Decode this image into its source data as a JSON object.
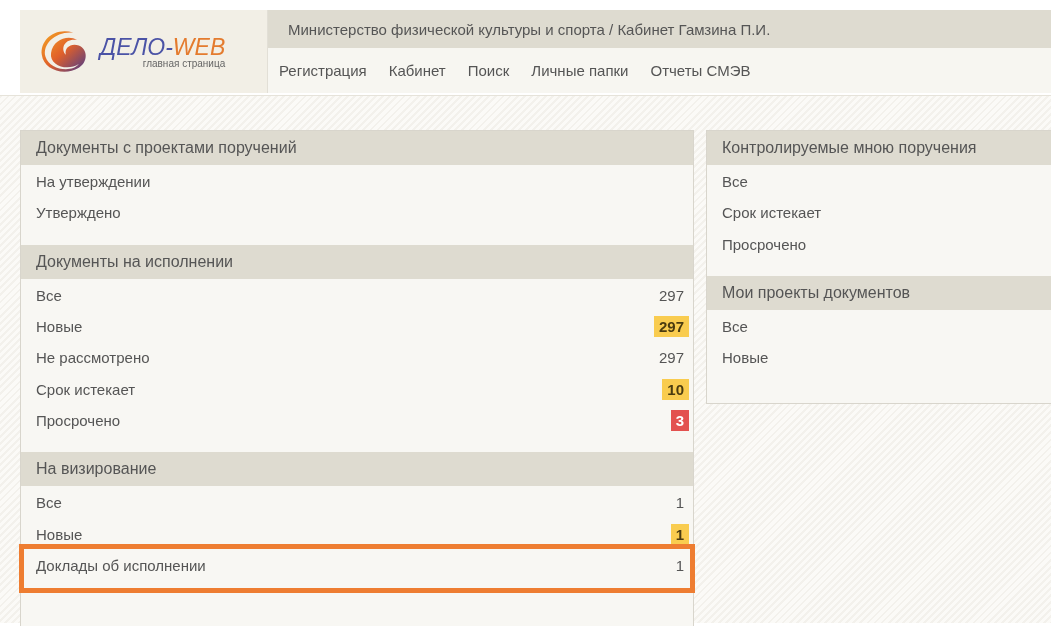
{
  "logo": {
    "name_part1": "ДЕЛО-",
    "name_part2": "WEB",
    "subtitle": "главная страница"
  },
  "header_title": "Министерство физической культуры и спорта / Кабинет Гамзина П.И.",
  "nav": [
    "Регистрация",
    "Кабинет",
    "Поиск",
    "Личные папки",
    "Отчеты СМЭВ"
  ],
  "left_panel": [
    {
      "title": "Документы с проектами поручений",
      "items": [
        {
          "label": "На утверждении",
          "highlighted": false
        },
        {
          "label": "Утверждено",
          "highlighted": false
        }
      ]
    },
    {
      "title": "Документы на исполнении",
      "items": [
        {
          "label": "Все",
          "count": "297",
          "kind": "plain",
          "highlighted": false
        },
        {
          "label": "Новые",
          "count": "297",
          "kind": "warning",
          "highlighted": false
        },
        {
          "label": "Не рассмотрено",
          "count": "297",
          "kind": "plain",
          "highlighted": false
        },
        {
          "label": "Срок истекает",
          "count": "10",
          "kind": "warning",
          "highlighted": false
        },
        {
          "label": "Просрочено",
          "count": "3",
          "kind": "danger",
          "highlighted": false
        }
      ]
    },
    {
      "title": "На визирование",
      "items": [
        {
          "label": "Все",
          "count": "1",
          "kind": "plain",
          "highlighted": false
        },
        {
          "label": "Новые",
          "count": "1",
          "kind": "warning",
          "highlighted": false
        },
        {
          "label": "Доклады об исполнении",
          "count": "1",
          "kind": "plain",
          "highlighted": true
        }
      ]
    }
  ],
  "right_panel": [
    {
      "title": "Контролируемые мною поручения",
      "items": [
        {
          "label": "Все",
          "highlighted": false
        },
        {
          "label": "Срок истекает",
          "highlighted": false
        },
        {
          "label": "Просрочено",
          "highlighted": false
        }
      ]
    },
    {
      "title": "Мои проекты документов",
      "items": [
        {
          "label": "Все",
          "highlighted": false
        },
        {
          "label": "Новые",
          "highlighted": false
        }
      ]
    }
  ]
}
